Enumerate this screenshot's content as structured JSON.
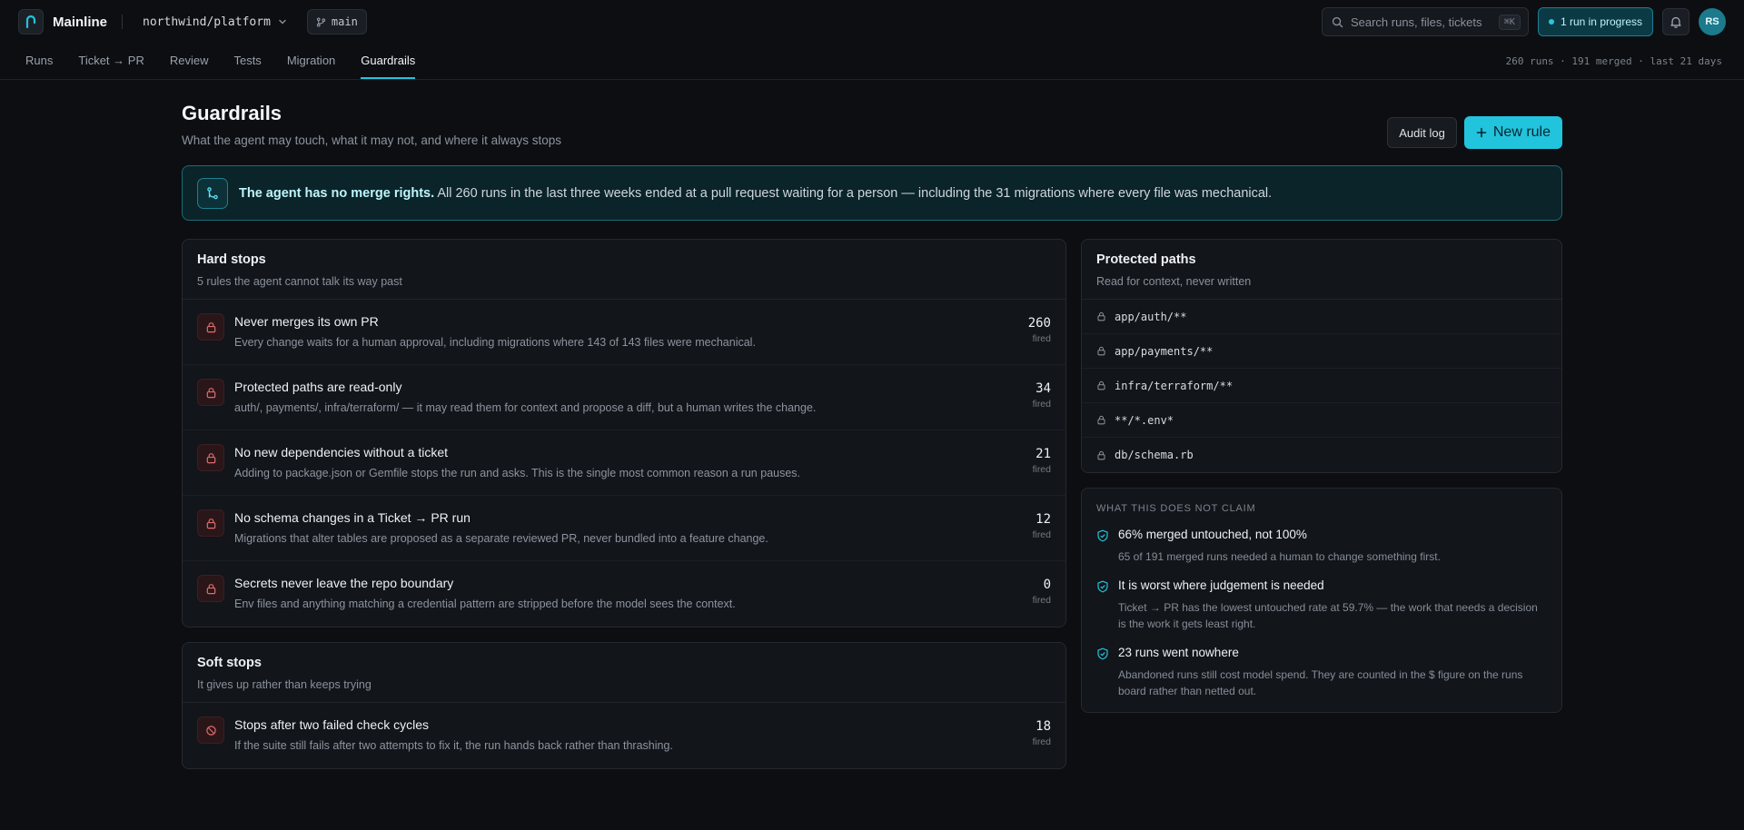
{
  "app": {
    "name": "Mainline",
    "repo": "northwind/platform",
    "branch": "main"
  },
  "search": {
    "placeholder": "Search runs, files, tickets",
    "shortcut": "⌘K"
  },
  "status": {
    "runs_in_progress": "1 run in progress"
  },
  "user": {
    "initials": "RS"
  },
  "nav": {
    "tabs": [
      "Runs",
      "Ticket → PR",
      "Review",
      "Tests",
      "Migration",
      "Guardrails"
    ],
    "active": "Guardrails",
    "stats": "260 runs · 191 merged · last 21 days"
  },
  "page": {
    "title": "Guardrails",
    "subtitle": "What the agent may touch, what it may not, and where it always stops",
    "audit_label": "Audit log",
    "new_rule_label": "New rule"
  },
  "banner": {
    "strong": "The agent has no merge rights.",
    "text": " All 260 runs in the last three weeks ended at a pull request waiting for a person — including the 31 migrations where every file was mechanical."
  },
  "hard_stops": {
    "title": "Hard stops",
    "subtitle": "5 rules the agent cannot talk its way past",
    "rules": [
      {
        "title": "Never merges its own PR",
        "desc": "Every change waits for a human approval, including migrations where 143 of 143 files were mechanical.",
        "count": "260",
        "unit": "fired"
      },
      {
        "title": "Protected paths are read-only",
        "desc": "auth/, payments/, infra/terraform/ — it may read them for context and propose a diff, but a human writes the change.",
        "count": "34",
        "unit": "fired"
      },
      {
        "title": "No new dependencies without a ticket",
        "desc": "Adding to package.json or Gemfile stops the run and asks. This is the single most common reason a run pauses.",
        "count": "21",
        "unit": "fired"
      },
      {
        "title": "No schema changes in a Ticket → PR run",
        "desc": "Migrations that alter tables are proposed as a separate reviewed PR, never bundled into a feature change.",
        "count": "12",
        "unit": "fired"
      },
      {
        "title": "Secrets never leave the repo boundary",
        "desc": "Env files and anything matching a credential pattern are stripped before the model sees the context.",
        "count": "0",
        "unit": "fired"
      }
    ]
  },
  "soft_stops": {
    "title": "Soft stops",
    "subtitle": "It gives up rather than keeps trying",
    "rules": [
      {
        "title": "Stops after two failed check cycles",
        "desc": "If the suite still fails after two attempts to fix it, the run hands back rather than thrashing.",
        "count": "18",
        "unit": "fired"
      }
    ]
  },
  "protected_paths": {
    "title": "Protected paths",
    "subtitle": "Read for context, never written",
    "paths": [
      "app/auth/**",
      "app/payments/**",
      "infra/terraform/**",
      "**/*.env*",
      "db/schema.rb"
    ]
  },
  "claims": {
    "heading": "WHAT THIS DOES NOT CLAIM",
    "items": [
      {
        "title": "66% merged untouched, not 100%",
        "desc": "65 of 191 merged runs needed a human to change something first."
      },
      {
        "title": "It is worst where judgement is needed",
        "desc": "Ticket → PR has the lowest untouched rate at 59.7% — the work that needs a decision is the work it gets least right."
      },
      {
        "title": "23 runs went nowhere",
        "desc": "Abandoned runs still cost model spend. They are counted in the $ figure on the runs board rather than netted out."
      }
    ]
  },
  "colors": {
    "accent": "#22c3dd",
    "danger": "#e06b6b",
    "bg": "#0c0e12"
  }
}
